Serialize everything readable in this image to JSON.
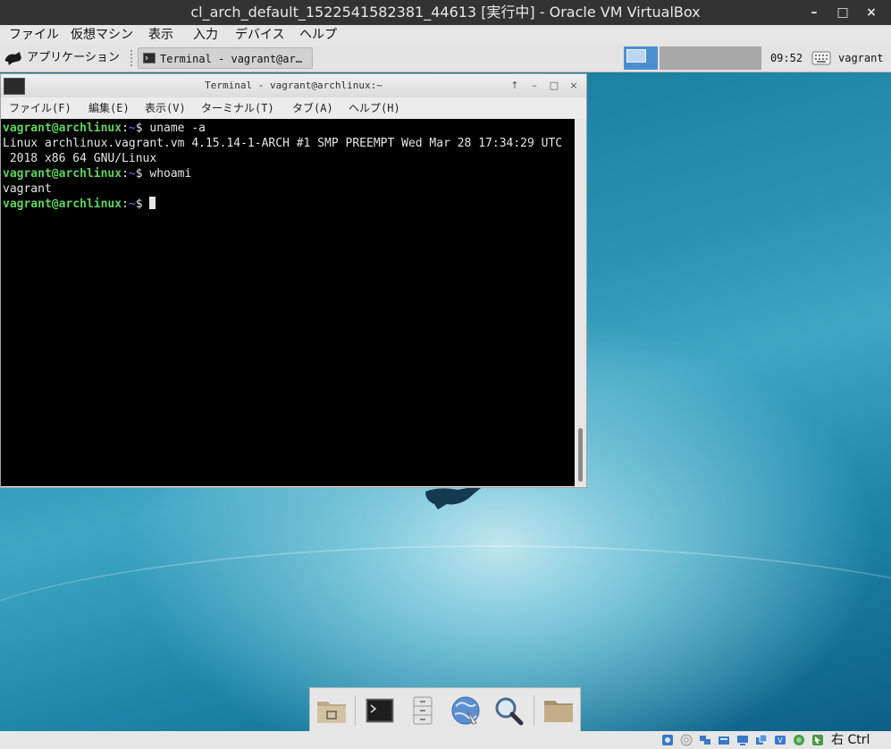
{
  "vbox": {
    "title": "cl_arch_default_1522541582381_44613 [実行中] - Oracle VM VirtualBox",
    "controls": {
      "minimize": "–",
      "maximize": "□",
      "close": "×"
    },
    "menu": [
      "ファイル",
      "仮想マシン",
      "表示",
      "入力",
      "デバイス",
      "ヘルプ"
    ],
    "statusbar": {
      "host_key": "右 Ctrl"
    }
  },
  "panel": {
    "apps_label": "アプリケーション",
    "task_label": "Terminal - vagrant@ar…",
    "clock": "09:52",
    "user": "vagrant"
  },
  "terminal": {
    "title": "Terminal - vagrant@archlinux:~",
    "controls": {
      "up": "↑",
      "minimize": "–",
      "maximize": "□",
      "close": "×"
    },
    "menu": [
      "ファイル(F)",
      "編集(E)",
      "表示(V)",
      "ターミナル(T)",
      "タブ(A)",
      "ヘルプ(H)"
    ],
    "prompt_user": "vagrant@archlinux",
    "prompt_dir": "~",
    "lines": [
      {
        "cmd": "uname -a"
      },
      {
        "out": "Linux archlinux.vagrant.vm 4.15.14-1-ARCH #1 SMP PREEMPT Wed Mar 28 17:34:29 UTC"
      },
      {
        "out": " 2018 x86 64 GNU/Linux"
      },
      {
        "cmd": "whoami"
      },
      {
        "out": "vagrant"
      }
    ]
  },
  "dock": {
    "items": [
      "home-folder-icon",
      "terminal-icon",
      "file-cabinet-icon",
      "web-browser-icon",
      "search-icon",
      "folder-icon"
    ]
  },
  "colors": {
    "prompt_user": "#5fd35f",
    "prompt_dir": "#5c7cff",
    "workspace_active": "#4a90d0"
  }
}
